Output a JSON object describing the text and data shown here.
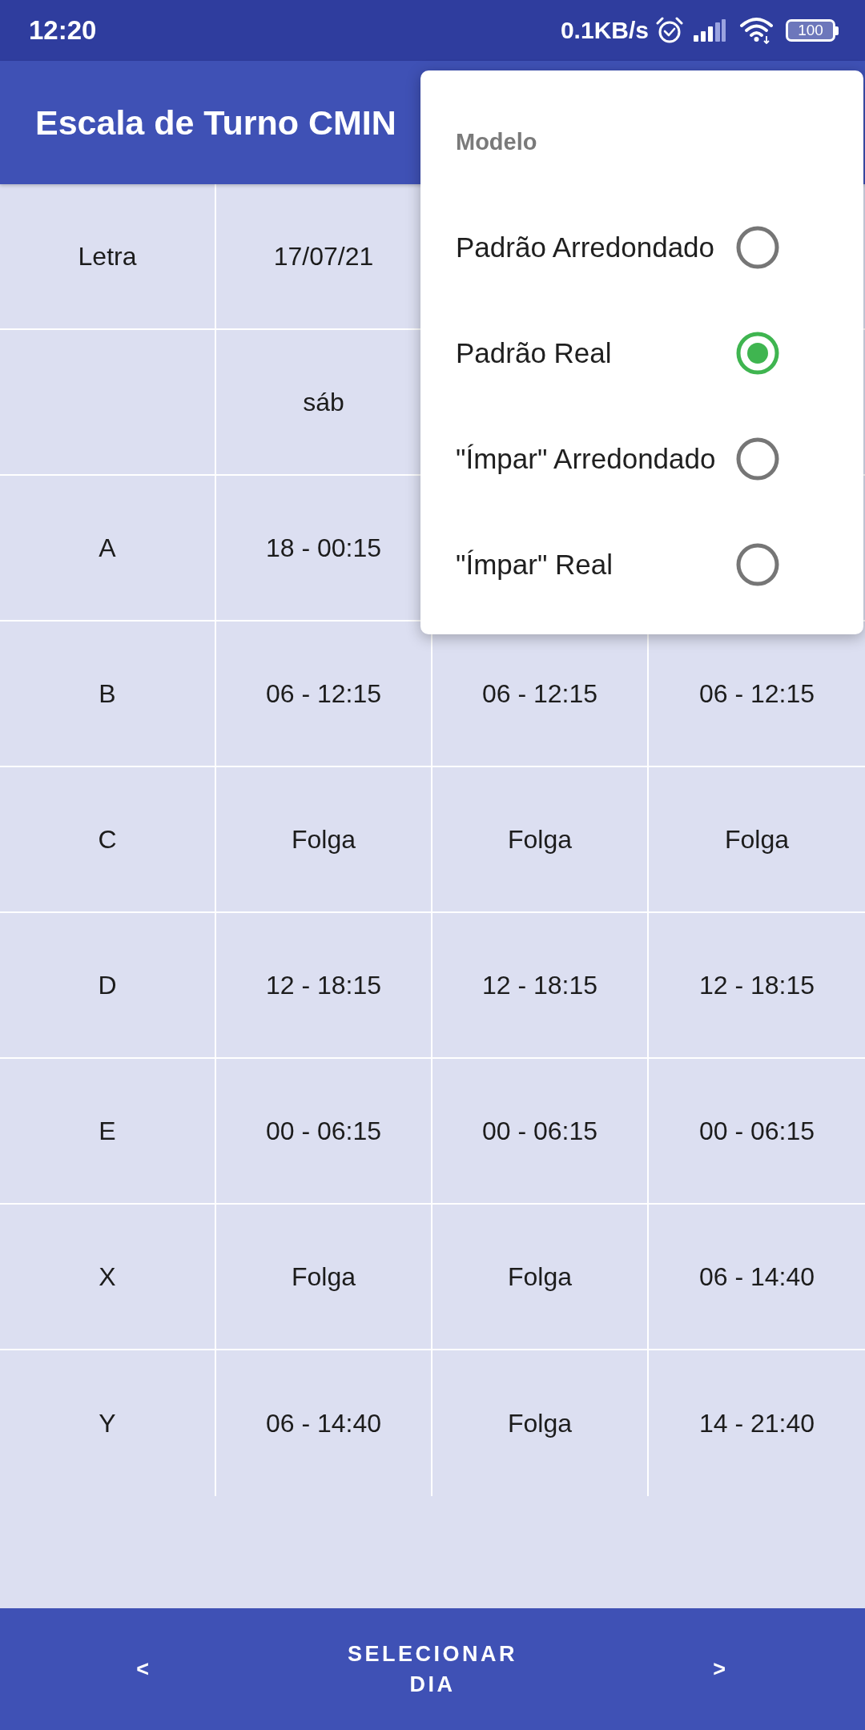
{
  "status_bar": {
    "time": "12:20",
    "network_speed": "0.1KB/s",
    "battery": "100"
  },
  "app_bar": {
    "title": "Escala de Turno CMIN"
  },
  "table": {
    "rows": [
      {
        "label": "Letra",
        "cells": [
          "17/07/21"
        ]
      },
      {
        "cells": [
          "sáb"
        ]
      },
      {
        "label": "A",
        "cells": [
          "18 - 00:15"
        ]
      },
      {
        "label": "B",
        "cells": [
          "06 - 12:15",
          "06 - 12:15",
          "06 - 12:15"
        ]
      },
      {
        "label": "C",
        "cells": [
          "Folga",
          "Folga",
          "Folga"
        ]
      },
      {
        "label": "D",
        "cells": [
          "12 - 18:15",
          "12 - 18:15",
          "12 - 18:15"
        ]
      },
      {
        "label": "E",
        "cells": [
          "00 - 06:15",
          "00 - 06:15",
          "00 - 06:15"
        ]
      },
      {
        "label": "X",
        "cells": [
          "Folga",
          "Folga",
          "06 - 14:40"
        ]
      },
      {
        "label": "Y",
        "cells": [
          "06 - 14:40",
          "Folga",
          "14 - 21:40"
        ]
      }
    ]
  },
  "popup_menu": {
    "title": "Modelo",
    "options": [
      {
        "label": "Padrão Arredondado",
        "selected": false
      },
      {
        "label": "Padrão Real",
        "selected": true
      },
      {
        "label": "\"Ímpar\" Arredondado",
        "selected": false
      },
      {
        "label": "\"Ímpar\" Real",
        "selected": false
      }
    ]
  },
  "bottom_bar": {
    "buttons": [
      "<",
      "SELECIONAR DIA",
      ">"
    ]
  }
}
